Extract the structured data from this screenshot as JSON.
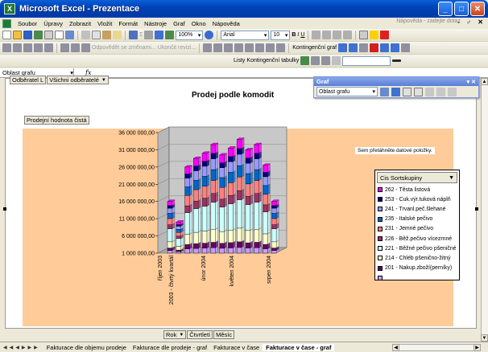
{
  "window": {
    "title": "Microsoft Excel - Prezentace",
    "minimize": "_",
    "maximize": "□",
    "close": "✕"
  },
  "menu": {
    "items": [
      "Soubor",
      "Úpravy",
      "Zobrazit",
      "Vložit",
      "Formát",
      "Nástroje",
      "Graf",
      "Okno",
      "Nápověda"
    ],
    "help_placeholder": "Nápověda - zadejte dotaz",
    "doc_controls": "- ♂ ✕"
  },
  "toolbar1": {
    "zoom": "100%",
    "font_name": "Arial",
    "font_size": "10",
    "bold": "B",
    "italic": "I",
    "underline": "U",
    "sigma": "Σ"
  },
  "toolbar2": {
    "reply_changes": "Odpovědět se změnami...",
    "end_review": "Ukončit revizi...",
    "chart_label": "Kontingenční graf"
  },
  "toolbar3": {
    "lists": "Listy",
    "pivot_tables": "Kontingenční tabulky"
  },
  "formula_bar": {
    "name_box": "Oblast grafu",
    "fx": "fx"
  },
  "page_fields": {
    "field1": "Odběratel L",
    "field2": "Všichni odběratelé"
  },
  "graf_toolbar": {
    "title": "Graf",
    "object_select": "Oblast grafu"
  },
  "chart_data": {
    "type": "bar",
    "title": "Prodej podle komodit",
    "data_field": "Prodejní hodnota čistá",
    "y_ticks": [
      "1 000 000,00",
      "6 000 000,00",
      "11 000 000,00",
      "16 000 000,00",
      "21 000 000,00",
      "26 000 000,00",
      "31 000 000,00",
      "36 000 000,00"
    ],
    "ylim": [
      1000000,
      36000000
    ],
    "stacked": true,
    "three_d": true,
    "x_labels": [
      "říjen 2003",
      "2003 - čtvrtý kvartál",
      "únor 2004",
      "květen 2004",
      "srpen 2004"
    ],
    "totals": [
      16000000,
      10000000,
      26000000,
      28500000,
      30000000,
      32500000,
      29500000,
      31500000,
      34000000,
      31000000,
      32500000,
      26500000,
      16000000
    ],
    "series_colors": [
      "#ff00ff",
      "#000080",
      "#9999ff",
      "#0066cc",
      "#ff8080",
      "#993366",
      "#ccffff",
      "#ffffcc",
      "#660066",
      "#cc99ff"
    ],
    "legend_title": "Cis Sortskupiny",
    "legend": [
      {
        "label": "262 - Těsta listová",
        "color": "#ff00ff"
      },
      {
        "label": "253 - Cuk.výr.tuková náplň",
        "color": "#000080"
      },
      {
        "label": "241 - Trvanl.peč.šlehané",
        "color": "#9999ff"
      },
      {
        "label": "235 - Italské pečivo",
        "color": "#0066cc"
      },
      {
        "label": "231 - Jemné pečivo",
        "color": "#ff8080"
      },
      {
        "label": "226 - Běž.pečivo vícezrnné",
        "color": "#993366"
      },
      {
        "label": "221 - Běžné pečivo pšeničné",
        "color": "#ccffff"
      },
      {
        "label": "214 - Chléb pšeničnо-žitný",
        "color": "#ffffcc"
      },
      {
        "label": "201 - Nakup.zboží(perníky)",
        "color": "#660066"
      },
      {
        "label": "",
        "color": "#cc99ff"
      }
    ]
  },
  "drop_hint": "Sem přetáhněte datové položky.",
  "bottom_fields": [
    "Rok",
    "Čtvrtletí",
    "Měsíc"
  ],
  "sheet_tabs": [
    "Fakturace dle objemu prodeje",
    "Fakturace dle prodeje - graf",
    "Fakturace v čase",
    "Fakturace v čase - graf"
  ],
  "active_tab_index": 3
}
